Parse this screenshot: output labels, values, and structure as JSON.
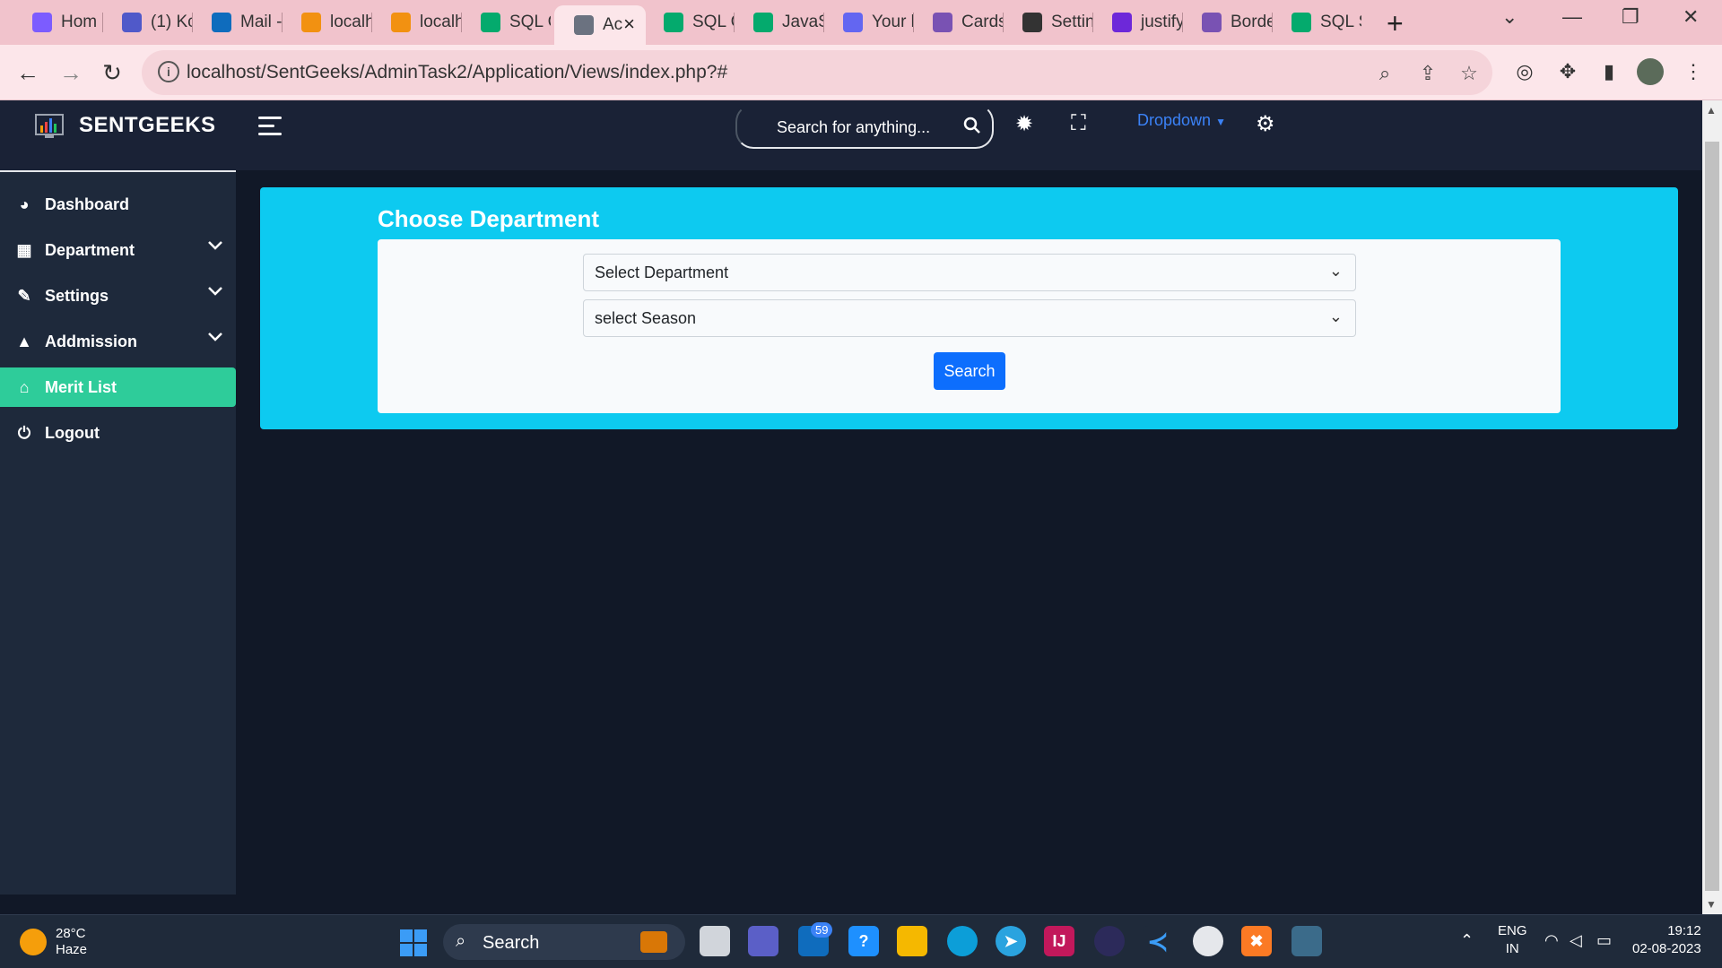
{
  "browser": {
    "tabs": [
      {
        "label": "Hom",
        "icon": "copilot-icon",
        "color": "#7c5cff"
      },
      {
        "label": "(1) Kc",
        "icon": "teams-icon",
        "color": "#5059c9"
      },
      {
        "label": "Mail -",
        "icon": "outlook-icon",
        "color": "#0f6cbd"
      },
      {
        "label": "localh",
        "icon": "phpmyadmin-icon",
        "color": "#f29111"
      },
      {
        "label": "localh",
        "icon": "phpmyadmin-icon",
        "color": "#f29111"
      },
      {
        "label": "SQL C",
        "icon": "w3schools-icon",
        "color": "#04aa6d"
      },
      {
        "label": "Ac",
        "icon": "page-icon",
        "color": "#6b7280"
      },
      {
        "label": "SQL C",
        "icon": "w3schools-icon",
        "color": "#04aa6d"
      },
      {
        "label": "JavaS",
        "icon": "w3schools-icon",
        "color": "#04aa6d"
      },
      {
        "label": "Your l",
        "icon": "flag-icon",
        "color": "#6366f1"
      },
      {
        "label": "Cards",
        "icon": "bootstrap-icon",
        "color": "#7952b3"
      },
      {
        "label": "Settin",
        "icon": "gear-icon",
        "color": "#333333"
      },
      {
        "label": "justify",
        "icon": "stack-icon",
        "color": "#6d28d9"
      },
      {
        "label": "Borde",
        "icon": "bootstrap-icon",
        "color": "#7952b3"
      },
      {
        "label": "SQL S",
        "icon": "w3schools-icon",
        "color": "#04aa6d"
      }
    ],
    "url": "localhost/SentGeeks/AdminTask2/Application/Views/index.php?#"
  },
  "app": {
    "brand": "SENTGEEKS",
    "search_placeholder": "Search for anything...",
    "dropdown_label": "Dropdown",
    "sidebar": [
      {
        "label": "Dashboard",
        "icon": "palette-icon",
        "has_chevron": false,
        "active": false
      },
      {
        "label": "Department",
        "icon": "building-icon",
        "has_chevron": true,
        "active": false
      },
      {
        "label": "Settings",
        "icon": "wrench-icon",
        "has_chevron": true,
        "active": false
      },
      {
        "label": "Addmission",
        "icon": "school-icon",
        "has_chevron": true,
        "active": false
      },
      {
        "label": "Merit List",
        "icon": "graduation-cap-icon",
        "has_chevron": false,
        "active": true
      },
      {
        "label": "Logout",
        "icon": "power-icon",
        "has_chevron": false,
        "active": false
      }
    ],
    "card": {
      "title": "Choose Department",
      "department_select": "Select Department",
      "season_select": "select Season",
      "search_button": "Search"
    },
    "colors": {
      "accent_cyan": "#0dcaf0",
      "active_green": "#2ecc9a",
      "button_blue": "#0d6efd"
    }
  },
  "taskbar": {
    "weather_temp": "28°C",
    "weather_desc": "Haze",
    "search_label": "Search",
    "mail_badge": "59",
    "lang_1": "ENG",
    "lang_2": "IN",
    "time": "19:12",
    "date": "02-08-2023"
  }
}
